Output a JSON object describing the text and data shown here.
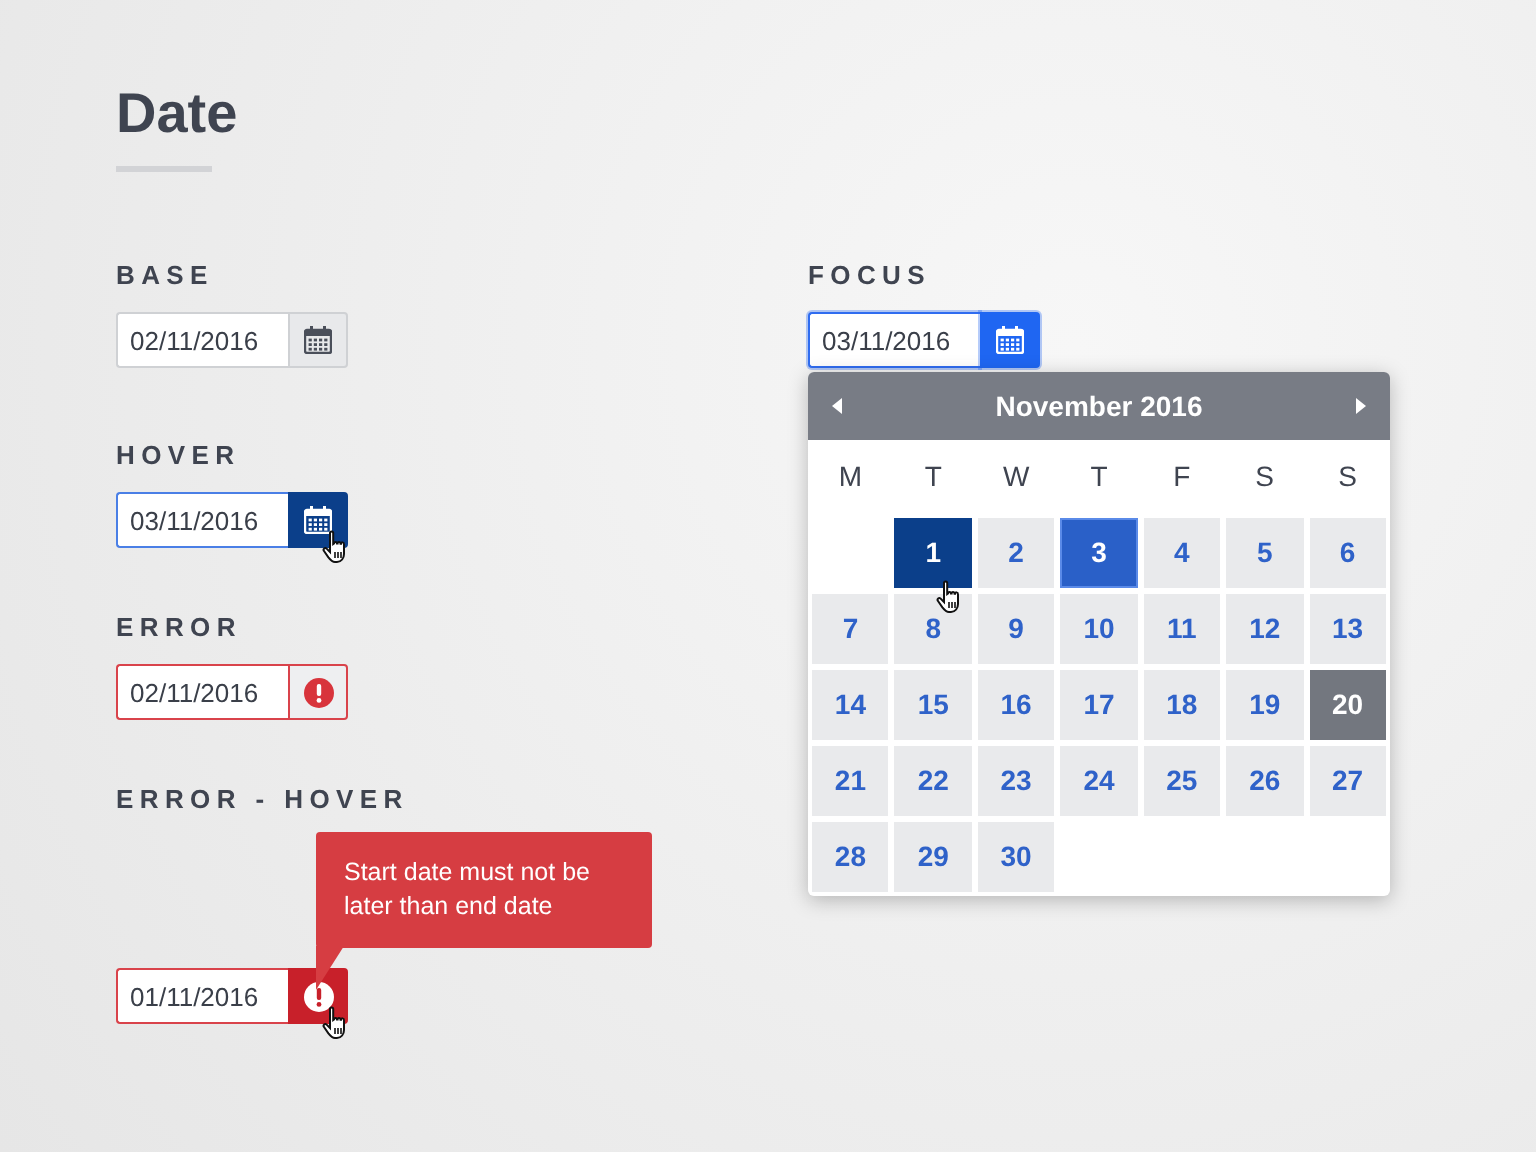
{
  "title": "Date",
  "states": [
    {
      "label": "BASE",
      "kind": "base",
      "value": "02/11/2016"
    },
    {
      "label": "HOVER",
      "kind": "hover",
      "value": "03/11/2016"
    },
    {
      "label": "ERROR",
      "kind": "error",
      "value": "02/11/2016"
    },
    {
      "label": "ERROR - HOVER",
      "kind": "error-hover",
      "value": "01/11/2016",
      "tooltip": "Start date must not be later than end date"
    }
  ],
  "focus": {
    "label": "FOCUS",
    "kind": "focus",
    "value": "03/11/2016",
    "calendar": {
      "month": "November 2016",
      "weekdays": [
        "M",
        "T",
        "W",
        "T",
        "F",
        "S",
        "S"
      ],
      "weeks": [
        [
          {
            "day": "1",
            "hovered": true,
            "selected": false,
            "today": false
          },
          {
            "day": "2",
            "hovered": false,
            "selected": false,
            "today": false
          },
          {
            "day": "3",
            "hovered": false,
            "selected": true,
            "today": false
          },
          {
            "day": "4",
            "hovered": false,
            "selected": false,
            "today": false
          },
          {
            "day": "5",
            "hovered": false,
            "selected": false,
            "today": false
          },
          {
            "day": "6",
            "hovered": false,
            "selected": false,
            "today": false
          }
        ],
        [
          {
            "day": "7",
            "hovered": false,
            "selected": false,
            "today": false
          },
          {
            "day": "8",
            "hovered": false,
            "selected": false,
            "today": false
          },
          {
            "day": "9",
            "hovered": false,
            "selected": false,
            "today": false
          },
          {
            "day": "10",
            "hovered": false,
            "selected": false,
            "today": false
          },
          {
            "day": "11",
            "hovered": false,
            "selected": false,
            "today": false
          },
          {
            "day": "12",
            "hovered": false,
            "selected": false,
            "today": false
          },
          {
            "day": "13",
            "hovered": false,
            "selected": false,
            "today": false
          }
        ],
        [
          {
            "day": "14",
            "hovered": false,
            "selected": false,
            "today": false
          },
          {
            "day": "15",
            "hovered": false,
            "selected": false,
            "today": false
          },
          {
            "day": "16",
            "hovered": false,
            "selected": false,
            "today": false
          },
          {
            "day": "17",
            "hovered": false,
            "selected": false,
            "today": false
          },
          {
            "day": "18",
            "hovered": false,
            "selected": false,
            "today": false
          },
          {
            "day": "19",
            "hovered": false,
            "selected": false,
            "today": false
          },
          {
            "day": "20",
            "hovered": false,
            "selected": false,
            "today": true
          }
        ],
        [
          {
            "day": "21",
            "hovered": false,
            "selected": false,
            "today": false
          },
          {
            "day": "22",
            "hovered": false,
            "selected": false,
            "today": false
          },
          {
            "day": "23",
            "hovered": false,
            "selected": false,
            "today": false
          },
          {
            "day": "24",
            "hovered": false,
            "selected": false,
            "today": false
          },
          {
            "day": "25",
            "hovered": false,
            "selected": false,
            "today": false
          },
          {
            "day": "26",
            "hovered": false,
            "selected": false,
            "today": false
          },
          {
            "day": "27",
            "hovered": false,
            "selected": false,
            "today": false
          }
        ],
        [
          {
            "day": "28",
            "hovered": false,
            "selected": false,
            "today": false
          },
          {
            "day": "29",
            "hovered": false,
            "selected": false,
            "today": false
          },
          {
            "day": "30",
            "hovered": false,
            "selected": false,
            "today": false
          }
        ]
      ]
    }
  }
}
